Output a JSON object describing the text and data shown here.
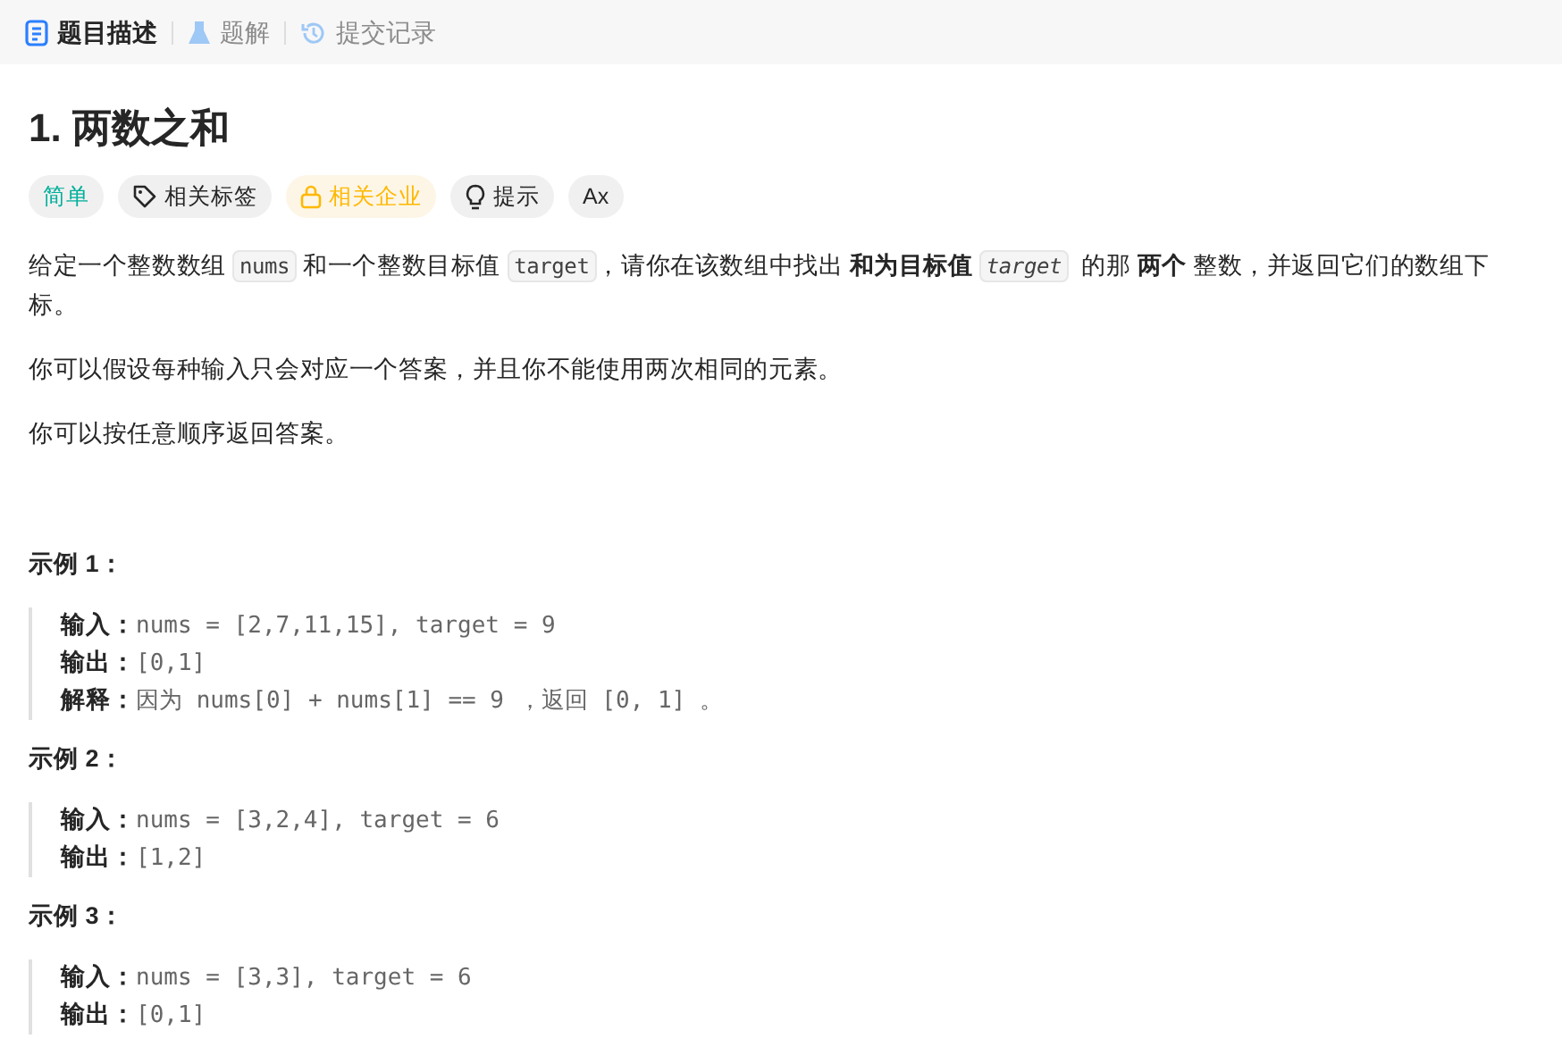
{
  "tabs": [
    {
      "label": "题目描述",
      "kind": "description",
      "selected": true
    },
    {
      "label": "题解",
      "kind": "solutions",
      "selected": false
    },
    {
      "label": "提交记录",
      "kind": "submissions",
      "selected": false
    }
  ],
  "title": "1. 两数之和",
  "tags": [
    {
      "label": "简单",
      "kind": "difficulty"
    },
    {
      "label": "相关标签",
      "kind": "topics"
    },
    {
      "label": "相关企业",
      "kind": "companies"
    },
    {
      "label": "提示",
      "kind": "hint"
    },
    {
      "label": "Ax",
      "kind": "translate"
    }
  ],
  "description": [
    [
      {
        "kind": "text",
        "text": "给定一个整数数组 "
      },
      {
        "kind": "code",
        "text": "nums"
      },
      {
        "kind": "text",
        "text": " 和一个整数目标值 "
      },
      {
        "kind": "code",
        "text": "target"
      },
      {
        "kind": "text",
        "text": "，请你在该数组中找出 **和为目标值** "
      },
      {
        "kind": "code-em",
        "text": "target"
      },
      {
        "kind": "text",
        "text": "  的那 **两个** 整数，并返回它们的数组下标。"
      }
    ],
    [
      {
        "kind": "text",
        "text": "你可以假设每种输入只会对应一个答案，并且你不能使用两次相同的元素。"
      }
    ],
    [
      {
        "kind": "text",
        "text": "你可以按任意顺序返回答案。"
      }
    ]
  ],
  "examples": [
    {
      "heading": "示例 1：",
      "lines": [
        {
          "label": "输入：",
          "value": "nums = [2,7,11,15], target = 9"
        },
        {
          "label": "输出：",
          "value": "[0,1]"
        },
        {
          "label": "解释：",
          "value": "因为 nums[0] + nums[1] == 9 ，返回 [0, 1] 。"
        }
      ]
    },
    {
      "heading": "示例 2：",
      "lines": [
        {
          "label": "输入：",
          "value": "nums = [3,2,4], target = 6"
        },
        {
          "label": "输出：",
          "value": "[1,2]"
        }
      ]
    },
    {
      "heading": "示例 3：",
      "lines": [
        {
          "label": "输入：",
          "value": "nums = [3,3], target = 6"
        },
        {
          "label": "输出：",
          "value": "[0,1]"
        }
      ]
    }
  ]
}
